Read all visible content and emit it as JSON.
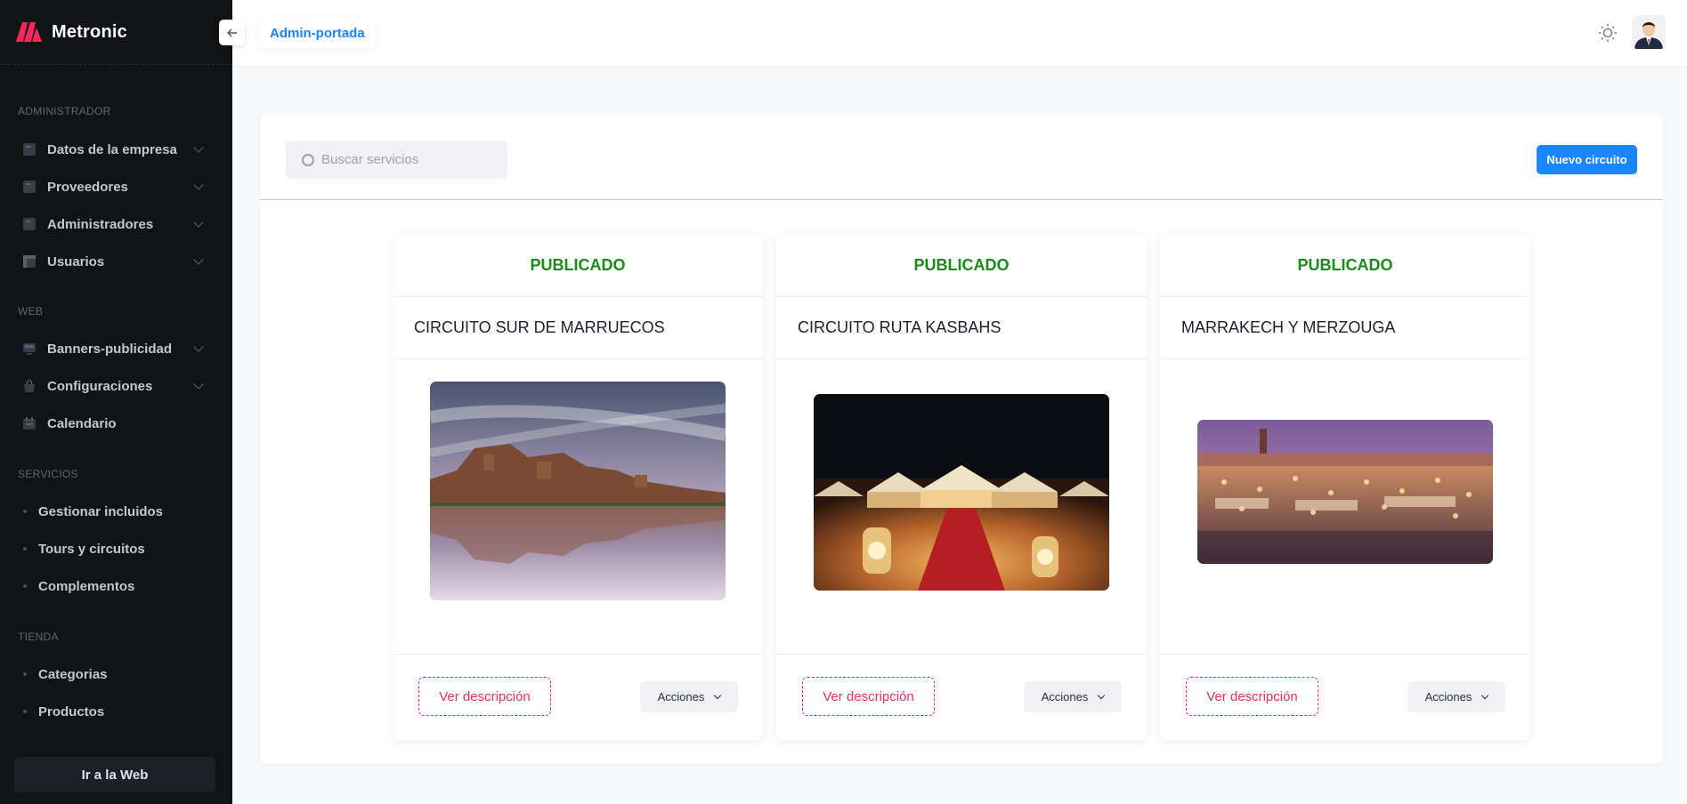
{
  "brand": {
    "name": "Metronic"
  },
  "topbar": {
    "breadcrumb": "Admin-portada",
    "collapse_icon": "arrow-left-icon",
    "theme_icon": "sun-icon"
  },
  "sidebar": {
    "sections": [
      {
        "label": "ADMINISTRADOR"
      },
      {
        "label": "WEB"
      },
      {
        "label": "SERVICIOS"
      },
      {
        "label": "TIENDA"
      }
    ],
    "items": [
      {
        "label": "Datos de la empresa",
        "icon": "document-icon"
      },
      {
        "label": "Proveedores",
        "icon": "document-icon"
      },
      {
        "label": "Administradores",
        "icon": "document-icon"
      },
      {
        "label": "Usuarios",
        "icon": "layout-icon"
      },
      {
        "label": "Banners-publicidad",
        "icon": "monitor-icon"
      },
      {
        "label": "Configuraciones",
        "icon": "basket-icon"
      },
      {
        "label": "Calendario",
        "icon": "calendar-icon"
      },
      {
        "label": "Gestionar incluidos"
      },
      {
        "label": "Tours y circuitos"
      },
      {
        "label": "Complementos"
      },
      {
        "label": "Categorias"
      },
      {
        "label": "Productos"
      }
    ],
    "web_button": "Ir a la Web"
  },
  "main": {
    "search": {
      "placeholder": "Buscar servicios",
      "value": ""
    },
    "new_button": "Nuevo circuito",
    "tours": [
      {
        "status": "PUBLICADO",
        "title": "CIRCUITO SUR DE MARRUECOS",
        "ver_label": "Ver descripción",
        "acciones_label": "Acciones"
      },
      {
        "status": "PUBLICADO",
        "title": "CIRCUITO RUTA KASBAHS",
        "ver_label": "Ver descripción",
        "acciones_label": "Acciones"
      },
      {
        "status": "PUBLICADO",
        "title": "MARRAKECH Y MERZOUGA",
        "ver_label": "Ver descripción",
        "acciones_label": "Acciones"
      }
    ]
  },
  "colors": {
    "primary": "#1b84ff",
    "published": "#1a8a1a",
    "danger": "#f0305c",
    "sidebar_bg": "#121317"
  }
}
